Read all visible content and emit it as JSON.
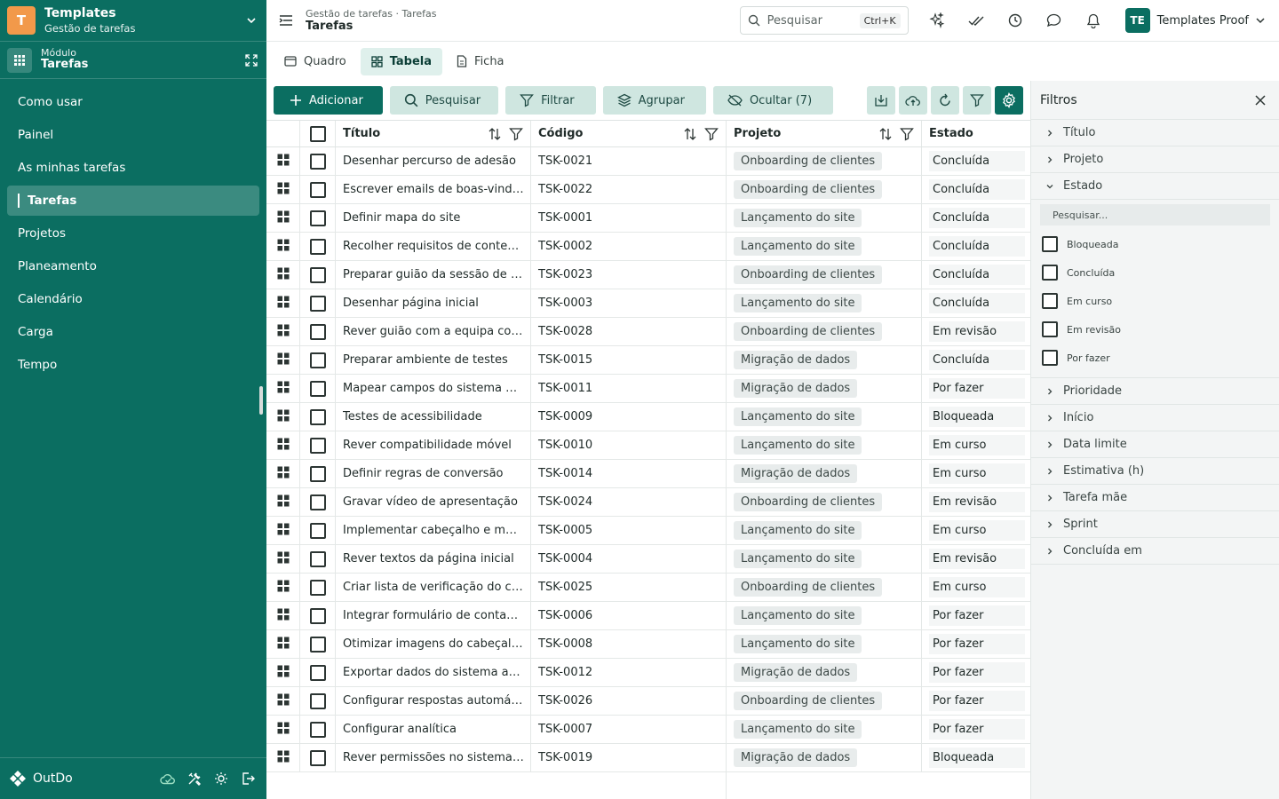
{
  "workspace": {
    "logo_letter": "T",
    "title": "Templates",
    "subtitle": "Gestão de tarefas"
  },
  "module": {
    "label": "Módulo",
    "name": "Tarefas"
  },
  "nav": [
    "Como usar",
    "Painel",
    "As minhas tarefas",
    "Tarefas",
    "Projetos",
    "Planeamento",
    "Calendário",
    "Carga",
    "Tempo"
  ],
  "active_nav": "Tarefas",
  "brand": "OutDo",
  "topbar": {
    "breadcrumb": "Gestão de tarefas · Tarefas",
    "title": "Tarefas",
    "search_placeholder": "Pesquisar",
    "shortcut": "Ctrl+K",
    "user_initials": "TE",
    "user_name": "Templates Proof"
  },
  "views": {
    "board": "Quadro",
    "table": "Tabela",
    "form": "Ficha"
  },
  "toolbar": {
    "add": "Adicionar",
    "search": "Pesquisar",
    "filter": "Filtrar",
    "group": "Agrupar",
    "hide": "Ocultar (7)"
  },
  "columns": {
    "title": "Título",
    "code": "Código",
    "project": "Projeto",
    "state": "Estado"
  },
  "rows": [
    {
      "title": "Desenhar percurso de adesão",
      "code": "TSK-0021",
      "project": "Onboarding de clientes",
      "state": "Concluída"
    },
    {
      "title": "Escrever emails de boas-vindas",
      "code": "TSK-0022",
      "project": "Onboarding de clientes",
      "state": "Concluída"
    },
    {
      "title": "Definir mapa do site",
      "code": "TSK-0001",
      "project": "Lançamento do site",
      "state": "Concluída"
    },
    {
      "title": "Recolher requisitos de conteúdo",
      "code": "TSK-0002",
      "project": "Lançamento do site",
      "state": "Concluída"
    },
    {
      "title": "Preparar guião da sessão de arr...",
      "code": "TSK-0023",
      "project": "Onboarding de clientes",
      "state": "Concluída"
    },
    {
      "title": "Desenhar página inicial",
      "code": "TSK-0003",
      "project": "Lançamento do site",
      "state": "Concluída"
    },
    {
      "title": "Rever guião com a equipa come...",
      "code": "TSK-0028",
      "project": "Onboarding de clientes",
      "state": "Em revisão"
    },
    {
      "title": "Preparar ambiente de testes",
      "code": "TSK-0015",
      "project": "Migração de dados",
      "state": "Concluída"
    },
    {
      "title": "Mapear campos do sistema anti...",
      "code": "TSK-0011",
      "project": "Migração de dados",
      "state": "Por fazer"
    },
    {
      "title": "Testes de acessibilidade",
      "code": "TSK-0009",
      "project": "Lançamento do site",
      "state": "Bloqueada"
    },
    {
      "title": "Rever compatibilidade móvel",
      "code": "TSK-0010",
      "project": "Lançamento do site",
      "state": "Em curso"
    },
    {
      "title": "Definir regras de conversão",
      "code": "TSK-0014",
      "project": "Migração de dados",
      "state": "Em curso"
    },
    {
      "title": "Gravar vídeo de apresentação",
      "code": "TSK-0024",
      "project": "Onboarding de clientes",
      "state": "Em revisão"
    },
    {
      "title": "Implementar cabeçalho e menu",
      "code": "TSK-0005",
      "project": "Lançamento do site",
      "state": "Em curso"
    },
    {
      "title": "Rever textos da página inicial",
      "code": "TSK-0004",
      "project": "Lançamento do site",
      "state": "Em revisão"
    },
    {
      "title": "Criar lista de verificação do clie...",
      "code": "TSK-0025",
      "project": "Onboarding de clientes",
      "state": "Em curso"
    },
    {
      "title": "Integrar formulário de contacto",
      "code": "TSK-0006",
      "project": "Lançamento do site",
      "state": "Por fazer"
    },
    {
      "title": "Otimizar imagens do cabeçalho",
      "code": "TSK-0008",
      "project": "Lançamento do site",
      "state": "Por fazer"
    },
    {
      "title": "Exportar dados do sistema antigo",
      "code": "TSK-0012",
      "project": "Migração de dados",
      "state": "Por fazer"
    },
    {
      "title": "Configurar respostas automátic...",
      "code": "TSK-0026",
      "project": "Onboarding de clientes",
      "state": "Por fazer"
    },
    {
      "title": "Configurar analítica",
      "code": "TSK-0007",
      "project": "Lançamento do site",
      "state": "Por fazer"
    },
    {
      "title": "Rever permissões no sistema no...",
      "code": "TSK-0019",
      "project": "Migração de dados",
      "state": "Bloqueada"
    }
  ],
  "filters": {
    "title": "Filtros",
    "before": [
      "Título",
      "Projeto"
    ],
    "open": "Estado",
    "search_placeholder": "Pesquisar...",
    "options": [
      "Bloqueada",
      "Concluída",
      "Em curso",
      "Em revisão",
      "Por fazer"
    ],
    "after": [
      "Prioridade",
      "Início",
      "Data limite",
      "Estimativa (h)",
      "Tarefa mãe",
      "Sprint",
      "Concluída em"
    ]
  },
  "colors": {
    "brand": "#0b6e61",
    "accent": "#f2994a"
  }
}
